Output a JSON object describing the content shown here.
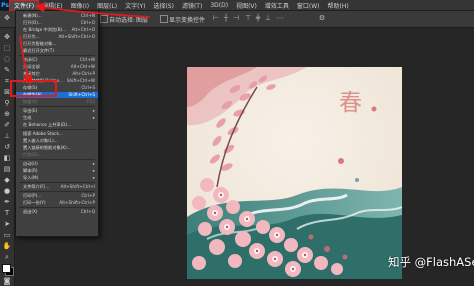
{
  "app": {
    "logo": "Ps"
  },
  "menubar": {
    "items": [
      "文件(F)",
      "编辑(E)",
      "图像(I)",
      "图层(L)",
      "文字(Y)",
      "选择(S)",
      "滤镜(T)",
      "3D(D)",
      "视图(V)",
      "增效工具",
      "窗口(W)",
      "帮助(H)"
    ],
    "active_index": 0
  },
  "optionsbar": {
    "auto_select_label": "自动选择:",
    "layer_label": "图层",
    "transform_label": "显示变换控件"
  },
  "file_menu": {
    "items": [
      {
        "label": "新建(N)...",
        "shortcut": "Ctrl+N",
        "state": "normal"
      },
      {
        "label": "打开(O)...",
        "shortcut": "Ctrl+O",
        "state": "normal"
      },
      {
        "label": "在 Bridge 中浏览(B)...",
        "shortcut": "Alt+Ctrl+O",
        "state": "normal"
      },
      {
        "label": "打开为...",
        "shortcut": "Alt+Shift+Ctrl+O",
        "state": "normal"
      },
      {
        "label": "打开为智能对象...",
        "shortcut": "",
        "state": "normal"
      },
      {
        "label": "最近打开文件(T)",
        "shortcut": "",
        "state": "normal"
      },
      {
        "label": "关闭(C)",
        "shortcut": "Ctrl+W",
        "state": "normal"
      },
      {
        "label": "关闭全部",
        "shortcut": "Alt+Ctrl+W",
        "state": "normal"
      },
      {
        "label": "关闭其它",
        "shortcut": "Alt+Ctrl+P",
        "state": "normal"
      },
      {
        "label": "关闭并转到 Bridge...",
        "shortcut": "Shift+Ctrl+W",
        "state": "normal"
      },
      {
        "label": "存储(S)",
        "shortcut": "Ctrl+S",
        "state": "normal"
      },
      {
        "label": "存储为(A)...",
        "shortcut": "Shift+Ctrl+S",
        "state": "highlighted"
      },
      {
        "label": "恢复(V)",
        "shortcut": "F12",
        "state": "dim"
      },
      {
        "label": "导出(E)",
        "shortcut": "",
        "state": "normal"
      },
      {
        "label": "生成",
        "shortcut": "",
        "state": "normal"
      },
      {
        "label": "在 Behance 上共享(D)...",
        "shortcut": "",
        "state": "normal"
      },
      {
        "label": "搜索 Adobe Stock...",
        "shortcut": "",
        "state": "normal"
      },
      {
        "label": "置入嵌入对象(L)...",
        "shortcut": "",
        "state": "normal"
      },
      {
        "label": "置入链接的智能对象(K)...",
        "shortcut": "",
        "state": "normal"
      },
      {
        "label": "打包(G)...",
        "shortcut": "",
        "state": "dim"
      },
      {
        "label": "自动(U)",
        "shortcut": "",
        "state": "normal"
      },
      {
        "label": "脚本(R)",
        "shortcut": "",
        "state": "normal"
      },
      {
        "label": "导入(M)",
        "shortcut": "",
        "state": "normal"
      },
      {
        "label": "文件简介(F)...",
        "shortcut": "Alt+Shift+Ctrl+I",
        "state": "normal"
      },
      {
        "label": "打印(P)...",
        "shortcut": "Ctrl+P",
        "state": "normal"
      },
      {
        "label": "打印一份(Y)",
        "shortcut": "Alt+Shift+Ctrl+P",
        "state": "normal"
      },
      {
        "label": "退出(X)",
        "shortcut": "Ctrl+Q",
        "state": "normal"
      }
    ]
  },
  "canvas": {
    "seal_text": "春"
  },
  "watermark": {
    "text": "知乎 @FlashASer"
  },
  "colors": {
    "highlight": "#1d6fd6",
    "annotation_red": "#e01b1b",
    "menu_bg": "#404040",
    "app_bg": "#262626"
  },
  "icons": [
    "move-tool-icon",
    "marquee-tool-icon",
    "lasso-tool-icon",
    "crop-tool-icon",
    "eyedropper-tool-icon",
    "brush-tool-icon",
    "stamp-tool-icon",
    "eraser-tool-icon",
    "gradient-tool-icon",
    "pen-tool-icon",
    "type-tool-icon",
    "hand-tool-icon",
    "zoom-tool-icon"
  ]
}
